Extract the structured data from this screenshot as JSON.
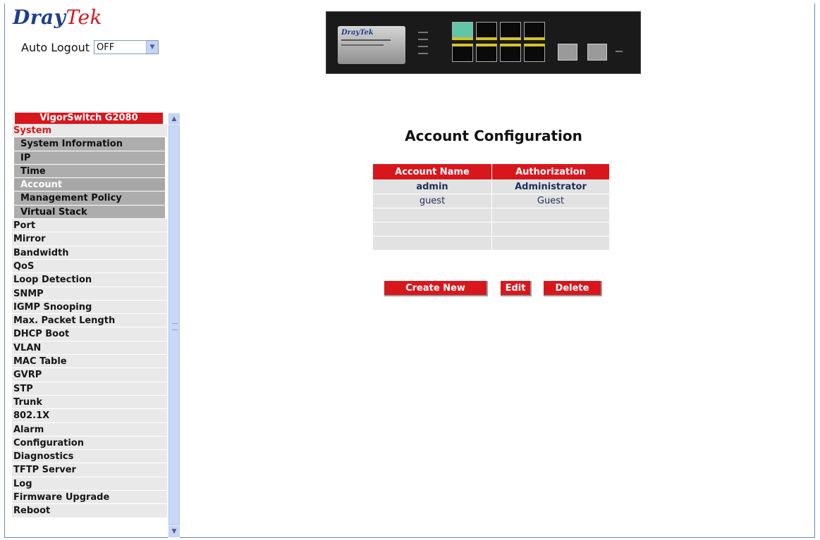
{
  "brand": {
    "logo_dray": "Dray",
    "logo_tek": "Tek"
  },
  "auto_logout": {
    "label": "Auto Logout",
    "value": "OFF"
  },
  "device": {
    "plate_text": "DrayTek"
  },
  "sidebar": {
    "header": "VigorSwitch G2080",
    "items": [
      {
        "label": "System",
        "kind": "system"
      },
      {
        "label": "System Information",
        "kind": "sub"
      },
      {
        "label": "IP",
        "kind": "sub"
      },
      {
        "label": "Time",
        "kind": "sub"
      },
      {
        "label": "Account",
        "kind": "sub-active"
      },
      {
        "label": "Management Policy",
        "kind": "sub"
      },
      {
        "label": "Virtual Stack",
        "kind": "sub"
      },
      {
        "label": "Port",
        "kind": "top"
      },
      {
        "label": "Mirror",
        "kind": "top"
      },
      {
        "label": "Bandwidth",
        "kind": "top"
      },
      {
        "label": "QoS",
        "kind": "top"
      },
      {
        "label": "Loop Detection",
        "kind": "top"
      },
      {
        "label": "SNMP",
        "kind": "top"
      },
      {
        "label": "IGMP Snooping",
        "kind": "top"
      },
      {
        "label": "Max. Packet Length",
        "kind": "top"
      },
      {
        "label": "DHCP Boot",
        "kind": "top"
      },
      {
        "label": "VLAN",
        "kind": "top"
      },
      {
        "label": "MAC Table",
        "kind": "top"
      },
      {
        "label": "GVRP",
        "kind": "top"
      },
      {
        "label": "STP",
        "kind": "top"
      },
      {
        "label": "Trunk",
        "kind": "top"
      },
      {
        "label": "802.1X",
        "kind": "top"
      },
      {
        "label": "Alarm",
        "kind": "top"
      },
      {
        "label": "Configuration",
        "kind": "top"
      },
      {
        "label": "Diagnostics",
        "kind": "top"
      },
      {
        "label": "TFTP Server",
        "kind": "top"
      },
      {
        "label": "Log",
        "kind": "top"
      },
      {
        "label": "Firmware Upgrade",
        "kind": "top"
      },
      {
        "label": "Reboot",
        "kind": "top"
      }
    ]
  },
  "main": {
    "title": "Account Configuration",
    "table": {
      "headers": [
        "Account Name",
        "Authorization"
      ],
      "rows": [
        [
          "admin",
          "Administrator"
        ],
        [
          "guest",
          "Guest"
        ],
        [
          "",
          ""
        ],
        [
          "",
          ""
        ],
        [
          "",
          ""
        ]
      ]
    },
    "buttons": {
      "create_new": "Create New",
      "edit": "Edit",
      "delete": "Delete"
    }
  },
  "colors": {
    "brand_red": "#d8171d",
    "brand_blue": "#1f3e8a",
    "menu_gray": "#e9e9e9",
    "submenu_gray": "#adadad"
  }
}
